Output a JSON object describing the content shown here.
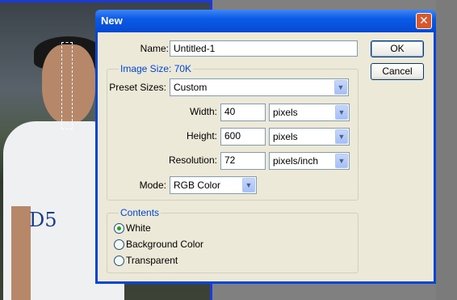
{
  "dialog": {
    "title": "New",
    "close_icon": "close-icon",
    "name_label": "Name:",
    "name_value": "Untitled-1",
    "image_size_label": "Image Size: 70K",
    "preset_label": "Preset Sizes:",
    "preset_value": "Custom",
    "width_label": "Width:",
    "width_value": "40",
    "width_unit": "pixels",
    "height_label": "Height:",
    "height_value": "600",
    "height_unit": "pixels",
    "resolution_label": "Resolution:",
    "resolution_value": "72",
    "resolution_unit": "pixels/inch",
    "mode_label": "Mode:",
    "mode_value": "RGB Color",
    "contents_label": "Contents",
    "contents_options": [
      "White",
      "Background Color",
      "Transparent"
    ],
    "contents_selected": "White",
    "ok_label": "OK",
    "cancel_label": "Cancel"
  },
  "background": {
    "shirt_text": "D5"
  }
}
